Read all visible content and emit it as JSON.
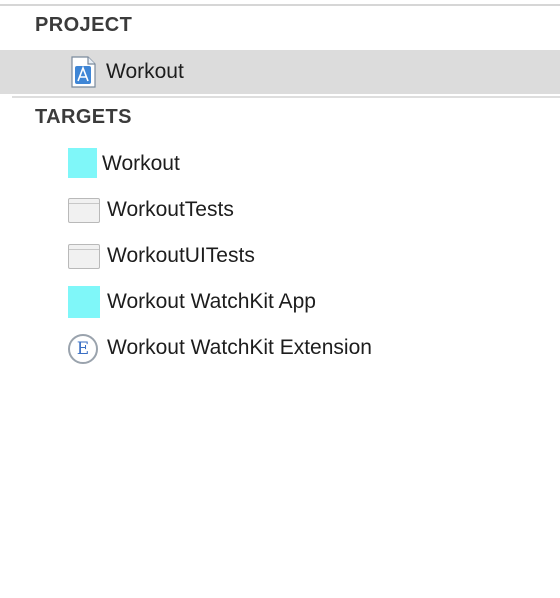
{
  "sections": {
    "project": {
      "header": "PROJECT",
      "items": [
        {
          "label": "Workout",
          "icon": "xcodeproj-file-icon",
          "selected": true
        }
      ]
    },
    "targets": {
      "header": "TARGETS",
      "items": [
        {
          "label": "Workout",
          "icon": "app-target-icon"
        },
        {
          "label": "WorkoutTests",
          "icon": "test-bundle-icon"
        },
        {
          "label": "WorkoutUITests",
          "icon": "test-bundle-icon"
        },
        {
          "label": "Workout WatchKit App",
          "icon": "watch-app-target-icon"
        },
        {
          "label": "Workout WatchKit Extension",
          "icon": "extension-icon"
        }
      ]
    }
  },
  "colors": {
    "selection_bg": "#dcdcdc",
    "app_icon": "#7ff7f9",
    "header_text": "#3b3b3b"
  },
  "icons": {
    "extension_glyph": "E"
  }
}
